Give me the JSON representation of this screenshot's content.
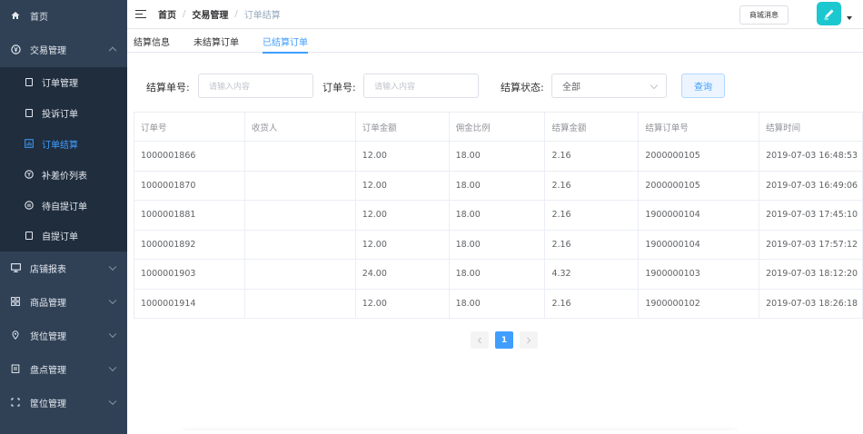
{
  "sidebar": {
    "home": "首页",
    "trade": {
      "label": "交易管理",
      "items": [
        "订单管理",
        "投诉订单",
        "订单结算",
        "补差价列表",
        "待自提订单",
        "自提订单"
      ],
      "active_index": 2
    },
    "groups": [
      "店铺报表",
      "商品管理",
      "货位管理",
      "盘点管理",
      "筐位管理"
    ]
  },
  "header": {
    "breadcrumb": [
      "首页",
      "交易管理",
      "订单结算"
    ],
    "message_button": "商城消息"
  },
  "tabs": [
    "结算信息",
    "未结算订单",
    "已结算订单"
  ],
  "active_tab": 2,
  "filter": {
    "settle_no_label": "结算单号:",
    "settle_no_placeholder": "请输入内容",
    "order_no_label": "订单号:",
    "order_no_placeholder": "请输入内容",
    "status_label": "结算状态:",
    "status_value": "全部",
    "query_button": "查询"
  },
  "table": {
    "columns": [
      "订单号",
      "收货人",
      "订单金额",
      "佣金比例",
      "结算金额",
      "结算订单号",
      "结算时间"
    ],
    "rows": [
      [
        "1000001866",
        "",
        "12.00",
        "18.00",
        "2.16",
        "2000000105",
        "2019-07-03 16:48:53"
      ],
      [
        "1000001870",
        "",
        "12.00",
        "18.00",
        "2.16",
        "2000000105",
        "2019-07-03 16:49:06"
      ],
      [
        "1000001881",
        "",
        "12.00",
        "18.00",
        "2.16",
        "1900000104",
        "2019-07-03 17:45:10"
      ],
      [
        "1000001892",
        "",
        "12.00",
        "18.00",
        "2.16",
        "1900000104",
        "2019-07-03 17:57:12"
      ],
      [
        "1000001903",
        "",
        "24.00",
        "18.00",
        "4.32",
        "1900000103",
        "2019-07-03 18:12:20"
      ],
      [
        "1000001914",
        "",
        "12.00",
        "18.00",
        "2.16",
        "1900000102",
        "2019-07-03 18:26:18"
      ]
    ]
  },
  "pagination": {
    "current_page": "1",
    "prev_icon": "chevron-left-icon",
    "next_icon": "chevron-right-icon"
  },
  "colors": {
    "sidebar_bg": "#304156",
    "submenu_bg": "#1f2d3d",
    "accent": "#409eff",
    "avatar_bg": "#1cc8cf"
  }
}
